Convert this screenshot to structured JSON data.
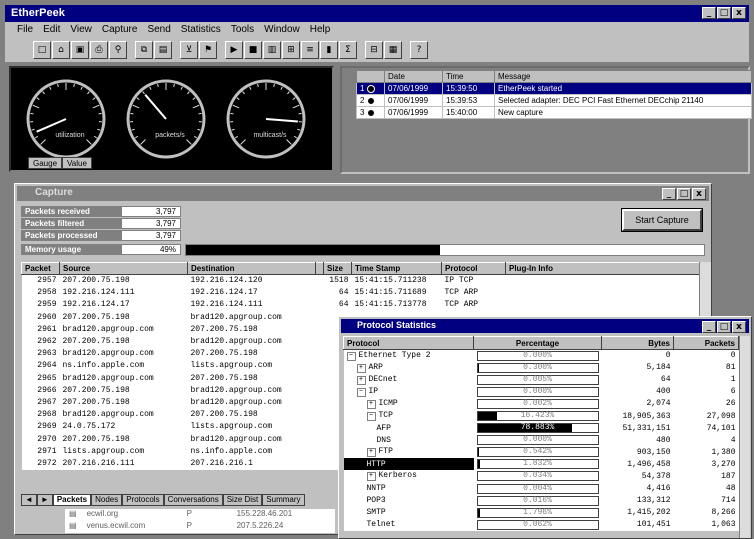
{
  "app": {
    "title": "EtherPeek"
  },
  "menu": [
    "File",
    "Edit",
    "View",
    "Capture",
    "Send",
    "Statistics",
    "Tools",
    "Window",
    "Help"
  ],
  "window_buttons": [
    "_",
    "□",
    "x"
  ],
  "toolbar_icons": [
    "new-icon",
    "open-icon",
    "save-icon",
    "print-icon",
    "find-icon",
    "sep",
    "copy-icon",
    "paste-icon",
    "sep",
    "filter-icon",
    "trigger-icon",
    "sep",
    "start-icon",
    "stop-icon",
    "stats-icon",
    "nodes-icon",
    "protocols-icon",
    "sizes-icon",
    "summary-icon",
    "sep",
    "decode-icon",
    "packet-icon",
    "sep",
    "help-icon"
  ],
  "gauges": {
    "labels": [
      "utilization",
      "packets/s",
      "multicast/s"
    ],
    "needle_fractions": [
      0.08,
      0.35,
      0.85
    ],
    "tabs": [
      "Gauge",
      "Value"
    ]
  },
  "log": {
    "columns": [
      "",
      "Date",
      "Time",
      "Message"
    ],
    "rows": [
      {
        "id": "1",
        "date": "07/06/1999",
        "time": "15:39:50",
        "message": "EtherPeek started",
        "selected": true
      },
      {
        "id": "2",
        "date": "07/06/1999",
        "time": "15:39:53",
        "message": "Selected adapter: DEC PCI Fast Ethernet DECchip 21140",
        "selected": false
      },
      {
        "id": "3",
        "date": "07/06/1999",
        "time": "15:40:00",
        "message": "New capture",
        "selected": false
      }
    ]
  },
  "capture": {
    "title": "Capture",
    "stats": [
      {
        "label": "Packets received",
        "value": "3,797"
      },
      {
        "label": "Packets filtered",
        "value": "3,797"
      },
      {
        "label": "Packets processed",
        "value": "3,797"
      },
      {
        "label": "Memory usage",
        "value": "49%"
      }
    ],
    "memory_fraction": 0.49,
    "start_button": "Start Capture",
    "columns": [
      "Packet",
      "Source",
      "Destination",
      "",
      "Size",
      "Time Stamp",
      "Protocol",
      "Plug-In Info"
    ],
    "packets": [
      [
        "2957",
        "207.200.75.198",
        "192.216.124.120",
        "",
        "1518",
        "15:41:15.711238",
        "IP TCP",
        ""
      ],
      [
        "2958",
        "192.216.124.111",
        "192.216.124.17",
        "",
        "64",
        "15:41:15.711689",
        "TCP ARP",
        ""
      ],
      [
        "2959",
        "192.216.124.17",
        "192.216.124.111",
        "",
        "64",
        "15:41:15.713778",
        "TCP ARP",
        ""
      ],
      [
        "2960",
        "207.200.75.198",
        "brad120.apgroup.com",
        "",
        "",
        "",
        "",
        ""
      ],
      [
        "2961",
        "brad120.apgroup.com",
        "207.200.75.198",
        "",
        "",
        "",
        "",
        ""
      ],
      [
        "2962",
        "207.200.75.198",
        "brad120.apgroup.com",
        "",
        "",
        "",
        "",
        ""
      ],
      [
        "2963",
        "brad120.apgroup.com",
        "207.200.75.198",
        "",
        "",
        "",
        "",
        ""
      ],
      [
        "2964",
        "ns.info.apple.com",
        "lists.apgroup.com",
        "",
        "",
        "",
        "",
        ""
      ],
      [
        "2965",
        "brad120.apgroup.com",
        "207.200.75.198",
        "",
        "",
        "",
        "",
        ""
      ],
      [
        "2966",
        "207.200.75.198",
        "brad120.apgroup.com",
        "",
        "",
        "",
        "",
        ""
      ],
      [
        "2967",
        "207.200.75.198",
        "brad120.apgroup.com",
        "",
        "",
        "",
        "",
        ""
      ],
      [
        "2968",
        "brad120.apgroup.com",
        "207.200.75.198",
        "",
        "",
        "",
        "",
        ""
      ],
      [
        "2969",
        "24.0.75.172",
        "lists.apgroup.com",
        "",
        "",
        "",
        "",
        ""
      ],
      [
        "2970",
        "207.200.75.198",
        "brad120.apgroup.com",
        "",
        "",
        "",
        "",
        ""
      ],
      [
        "2971",
        "lists.apgroup.com",
        "ns.info.apple.com",
        "",
        "",
        "",
        "",
        ""
      ],
      [
        "2972",
        "207.216.216.111",
        "207.216.216.1",
        "",
        "",
        "",
        "",
        ""
      ]
    ],
    "tabs": [
      "Packets",
      "Nodes",
      "Protocols",
      "Conversations",
      "Size Dist",
      "Summary"
    ],
    "active_tab": "Packets",
    "lower_list": [
      {
        "name": "ecwil.org",
        "flag": "P",
        "addr": "155.228.46.201"
      },
      {
        "name": "venus.ecwil.com",
        "flag": "P",
        "addr": "207.5.226.24"
      }
    ]
  },
  "protocol_stats": {
    "title": "Protocol Statistics",
    "columns": [
      "Protocol",
      "Percentage",
      "Bytes",
      "Packets"
    ],
    "rows": [
      {
        "name": "Ethernet Type 2",
        "indent": 0,
        "toggle": "−",
        "pct": "0.000%",
        "pct_value": 0.0,
        "bytes": "0",
        "packets": "0"
      },
      {
        "name": "ARP",
        "indent": 1,
        "toggle": "+",
        "pct": "0.300%",
        "pct_value": 0.3,
        "bytes": "5,184",
        "packets": "81"
      },
      {
        "name": "DECnet",
        "indent": 1,
        "toggle": "+",
        "pct": "0.005%",
        "pct_value": 0.005,
        "bytes": "64",
        "packets": "1"
      },
      {
        "name": "IP",
        "indent": 1,
        "toggle": "−",
        "pct": "0.000%",
        "pct_value": 0.0,
        "bytes": "400",
        "packets": "6"
      },
      {
        "name": "ICMP",
        "indent": 2,
        "toggle": "+",
        "pct": "0.002%",
        "pct_value": 0.002,
        "bytes": "2,074",
        "packets": "26"
      },
      {
        "name": "TCP",
        "indent": 2,
        "toggle": "−",
        "pct": "16.423%",
        "pct_value": 16.423,
        "bytes": "18,905,363",
        "packets": "27,098"
      },
      {
        "name": "AFP",
        "indent": 3,
        "toggle": "",
        "pct": "78.883%",
        "pct_value": 78.883,
        "bytes": "51,331,151",
        "packets": "74,101"
      },
      {
        "name": "DNS",
        "indent": 3,
        "toggle": "",
        "pct": "0.000%",
        "pct_value": 0.0,
        "bytes": "480",
        "packets": "4"
      },
      {
        "name": "FTP",
        "indent": 2,
        "toggle": "+",
        "pct": "0.542%",
        "pct_value": 0.542,
        "bytes": "903,150",
        "packets": "1,380"
      },
      {
        "name": "HTTP",
        "indent": 2,
        "toggle": "",
        "pct": "1.832%",
        "pct_value": 1.832,
        "bytes": "1,496,458",
        "packets": "3,270",
        "selected": true
      },
      {
        "name": "Kerberos",
        "indent": 2,
        "toggle": "+",
        "pct": "0.034%",
        "pct_value": 0.034,
        "bytes": "54,378",
        "packets": "187"
      },
      {
        "name": "NNTP",
        "indent": 2,
        "toggle": "",
        "pct": "0.004%",
        "pct_value": 0.004,
        "bytes": "4,416",
        "packets": "48"
      },
      {
        "name": "POP3",
        "indent": 2,
        "toggle": "",
        "pct": "0.016%",
        "pct_value": 0.016,
        "bytes": "133,312",
        "packets": "714"
      },
      {
        "name": "SMTP",
        "indent": 2,
        "toggle": "",
        "pct": "1.796%",
        "pct_value": 1.796,
        "bytes": "1,415,202",
        "packets": "8,266"
      },
      {
        "name": "Telnet",
        "indent": 2,
        "toggle": "",
        "pct": "0.062%",
        "pct_value": 0.062,
        "bytes": "101,451",
        "packets": "1,063"
      }
    ]
  }
}
